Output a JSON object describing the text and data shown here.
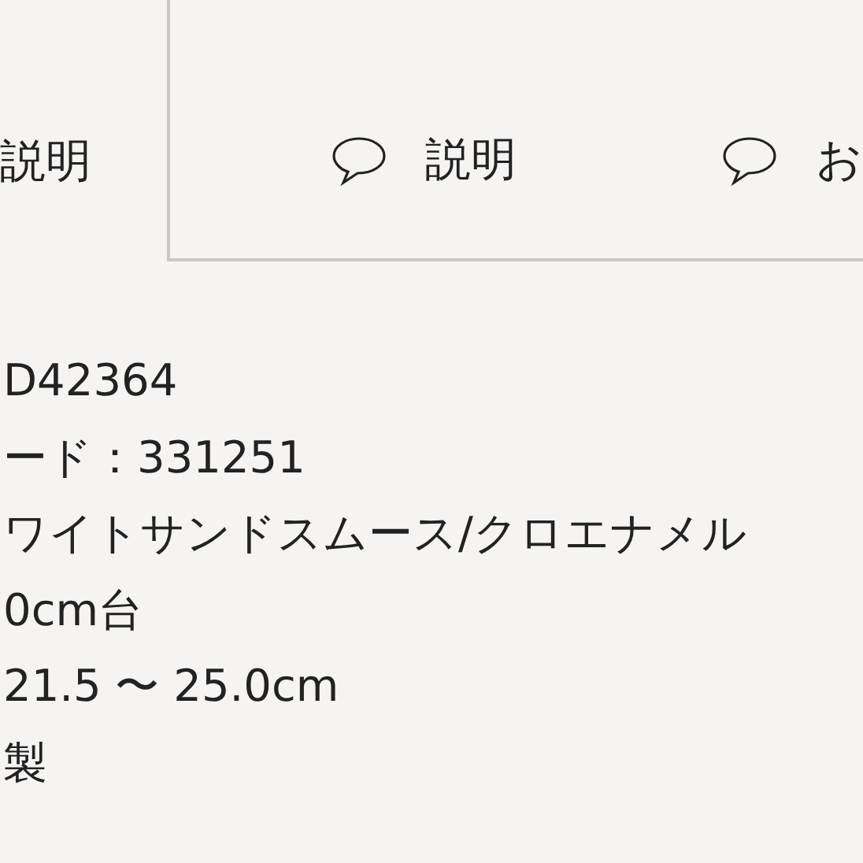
{
  "tabs": [
    {
      "label": "説明",
      "selected": true,
      "icon": false
    },
    {
      "label": "説明",
      "selected": false,
      "icon": true
    },
    {
      "label": "お",
      "selected": false,
      "icon": true
    }
  ],
  "details": [
    "D42364",
    "ード：331251",
    "ワイトサンドスムース/クロエナメル",
    "0cm台",
    "21.5 〜 25.0cm",
    "製"
  ]
}
